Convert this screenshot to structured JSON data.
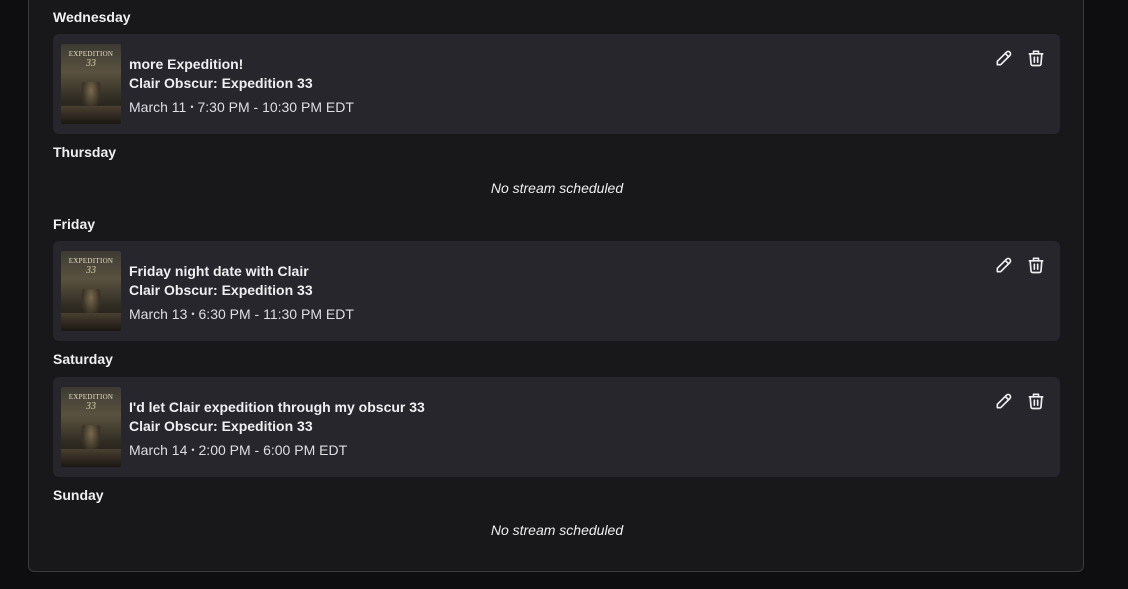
{
  "schedule": {
    "days": [
      {
        "label": "Wednesday",
        "stream": {
          "title": "more Expedition!",
          "game": "Clair Obscur: Expedition 33",
          "date": "March 11",
          "time": "7:30 PM - 10:30 PM EDT"
        }
      },
      {
        "label": "Thursday",
        "empty_text": "No stream scheduled"
      },
      {
        "label": "Friday",
        "stream": {
          "title": "Friday night date with Clair",
          "game": "Clair Obscur: Expedition 33",
          "date": "March 13",
          "time": "6:30 PM - 11:30 PM EDT"
        }
      },
      {
        "label": "Saturday",
        "stream": {
          "title": "I'd let Clair expedition through my obscur 33",
          "game": "Clair Obscur: Expedition 33",
          "date": "March 14",
          "time": "2:00 PM - 6:00 PM EDT"
        }
      },
      {
        "label": "Sunday",
        "empty_text": "No stream scheduled"
      }
    ],
    "separator": "•",
    "thumbnail": {
      "title_text": "EXPEDITION",
      "number_text": "33"
    },
    "icons": {
      "edit": "pencil-icon",
      "delete": "trash-icon"
    }
  }
}
